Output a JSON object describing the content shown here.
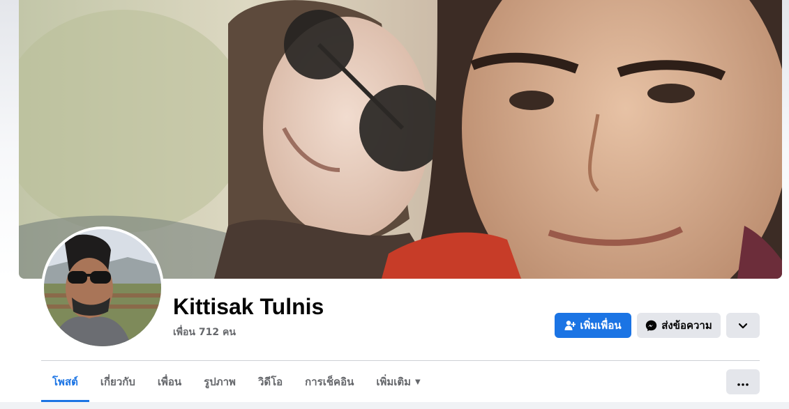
{
  "profile": {
    "name": "Kittisak Tulnis",
    "friends_text": "เพื่อน 712 คน",
    "cover_image": "couple-selfie-photo",
    "avatar_image": "man-with-sunglasses-photo"
  },
  "actions": {
    "add_friend_label": "เพิ่มเพื่อน",
    "add_friend_icon": "add-person-icon",
    "message_label": "ส่งข้อความ",
    "message_icon": "messenger-icon",
    "dropdown_icon": "chevron-down-icon"
  },
  "tabs": [
    {
      "label": "โพสต์",
      "active": true
    },
    {
      "label": "เกี่ยวกับ",
      "active": false
    },
    {
      "label": "เพื่อน",
      "active": false
    },
    {
      "label": "รูปภาพ",
      "active": false
    },
    {
      "label": "วิดีโอ",
      "active": false
    },
    {
      "label": "การเช็คอิน",
      "active": false
    },
    {
      "label": "เพิ่มเติม",
      "active": false,
      "has_caret": true
    }
  ],
  "colors": {
    "accent": "#1b74e4",
    "button_gray": "#e4e6eb",
    "muted_text": "#65676b",
    "divider": "#ced0d4"
  }
}
